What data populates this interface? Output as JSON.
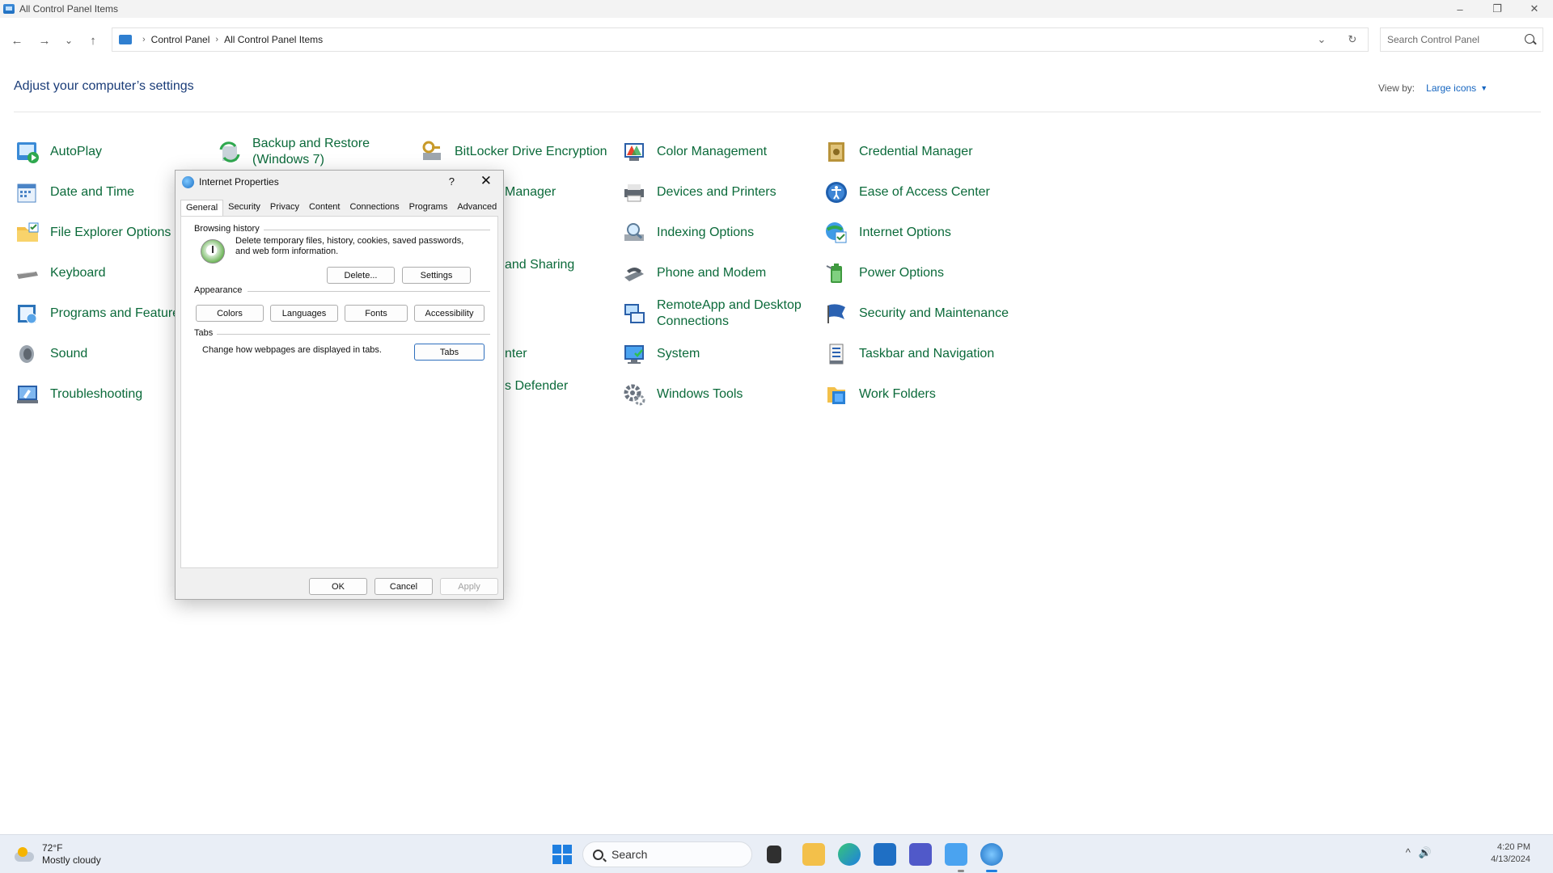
{
  "window": {
    "title": "All Control Panel Items",
    "minimize": "–",
    "restore": "❐",
    "close": "✕"
  },
  "nav": {
    "back": "←",
    "forward": "→",
    "recent": "⌄",
    "up": "↑",
    "breadcrumb": [
      "Control Panel",
      "All Control Panel Items"
    ],
    "separator": "›",
    "dropdown": "⌄",
    "refresh": "↻"
  },
  "search": {
    "placeholder": "Search Control Panel"
  },
  "heading": "Adjust your computer’s settings",
  "view_by": {
    "label": "View by:",
    "value": "Large icons",
    "caret": "▼"
  },
  "items": {
    "autoplay": "AutoPlay",
    "backup_restore": "Backup and Restore (Windows 7)",
    "bitlocker": "BitLocker Drive Encryption",
    "color_management": "Color Management",
    "credential_manager": "Credential Manager",
    "date_time": "Date and Time",
    "device_manager_partial": "Manager",
    "devices_printers": "Devices and Printers",
    "ease_of_access": "Ease of Access Center",
    "file_explorer": "File Explorer Options",
    "indexing": "Indexing Options",
    "internet_options": "Internet Options",
    "keyboard": "Keyboard",
    "network_partial": "and Sharing",
    "phone_modem": "Phone and Modem",
    "power_options": "Power Options",
    "programs_features": "Programs and Features",
    "remoteapp": "RemoteApp and Desktop Connections",
    "security_maintenance": "Security and Maintenance",
    "sound": "Sound",
    "sync_partial": "nter",
    "system": "System",
    "taskbar_navigation": "Taskbar and Navigation",
    "troubleshooting": "Troubleshooting",
    "defender_partial": "s Defender",
    "windows_tools": "Windows Tools",
    "work_folders": "Work Folders"
  },
  "dialog": {
    "title": "Internet Properties",
    "help": "?",
    "close": "✕",
    "tabs": [
      "General",
      "Security",
      "Privacy",
      "Content",
      "Connections",
      "Programs",
      "Advanced"
    ],
    "browsing_history": {
      "label": "Browsing history",
      "description": "Delete temporary files, history, cookies, saved passwords, and web form information.",
      "delete_button": "Delete...",
      "settings_button": "Settings"
    },
    "appearance": {
      "label": "Appearance",
      "colors_button": "Colors",
      "languages_button": "Languages",
      "fonts_button": "Fonts",
      "accessibility_button": "Accessibility"
    },
    "tabs_group": {
      "label": "Tabs",
      "description": "Change how webpages are displayed in tabs.",
      "tabs_button": "Tabs"
    },
    "ok_button": "OK",
    "cancel_button": "Cancel",
    "apply_button": "Apply"
  },
  "taskbar": {
    "weather_temp": "72°F",
    "weather_desc": "Mostly cloudy",
    "search_label": "Search",
    "time": "4:20 PM",
    "date": "4/13/2024",
    "tray_chevron": "^",
    "tray_volume": "🔊"
  }
}
